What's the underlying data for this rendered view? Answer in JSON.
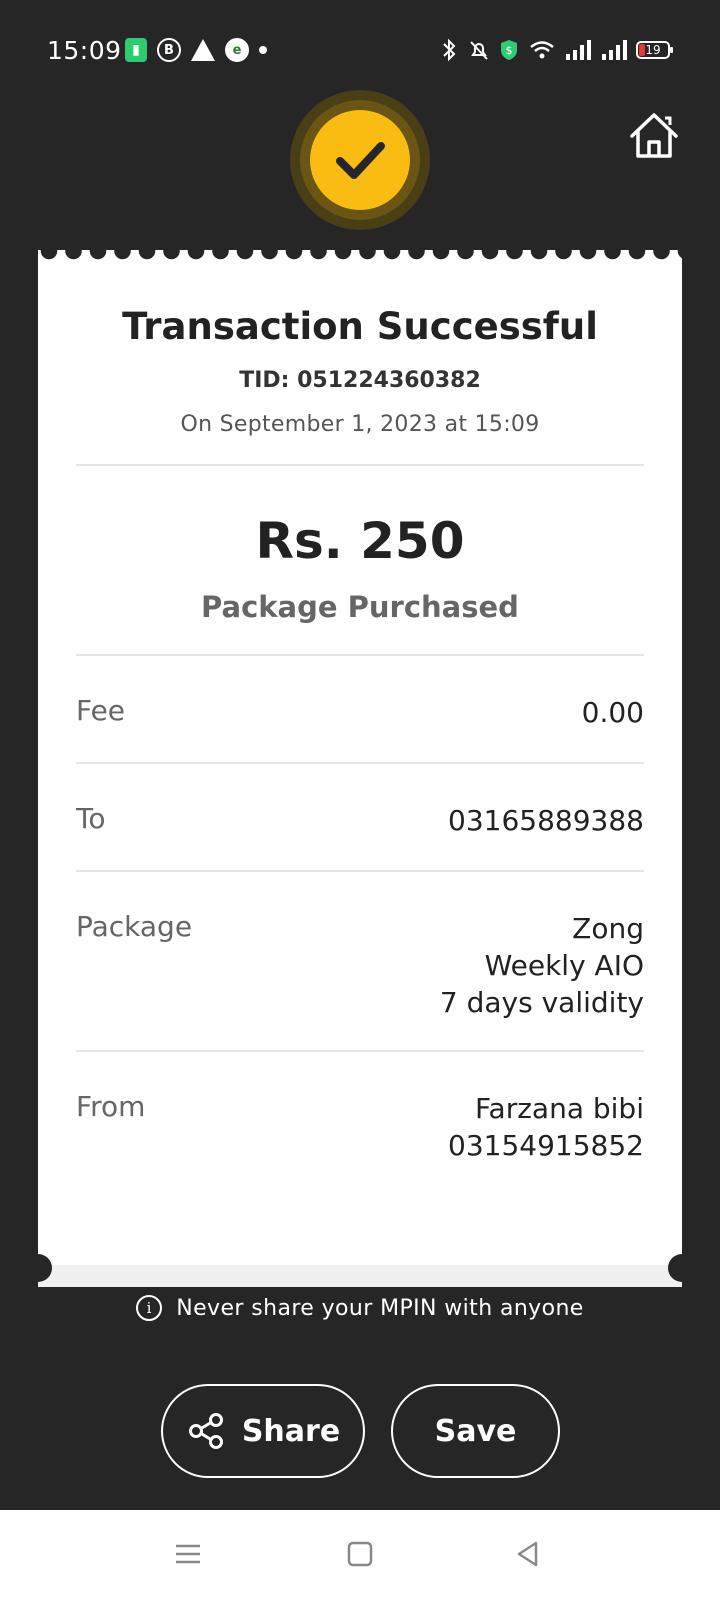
{
  "status_bar": {
    "time": "15:09",
    "left_icons": [
      "battery-saver-icon",
      "b-circle-icon",
      "warning-icon",
      "app-icon",
      "dot-icon"
    ],
    "right_icons": [
      "bluetooth-icon",
      "mute-icon",
      "shield-icon",
      "wifi-icon",
      "signal-icon",
      "signal-icon"
    ],
    "battery_level": "19"
  },
  "receipt": {
    "title": "Transaction Successful",
    "tid": "TID: 051224360382",
    "date": "On September 1, 2023 at 15:09",
    "amount": "Rs. 250",
    "amount_subtitle": "Package Purchased",
    "rows": [
      {
        "label": "Fee",
        "value_lines": [
          "0.00"
        ]
      },
      {
        "label": "To",
        "value_lines": [
          "03165889388"
        ]
      },
      {
        "label": "Package",
        "value_lines": [
          "Zong",
          "Weekly AIO",
          "7 days validity"
        ]
      },
      {
        "label": "From",
        "value_lines": [
          "Farzana bibi",
          "03154915852"
        ]
      }
    ]
  },
  "notice": "Never share your MPIN with anyone",
  "buttons": {
    "share_label": "Share",
    "save_label": "Save"
  },
  "colors": {
    "background": "#262626",
    "accent": "#fbbc12",
    "receipt": "#ffffff"
  }
}
